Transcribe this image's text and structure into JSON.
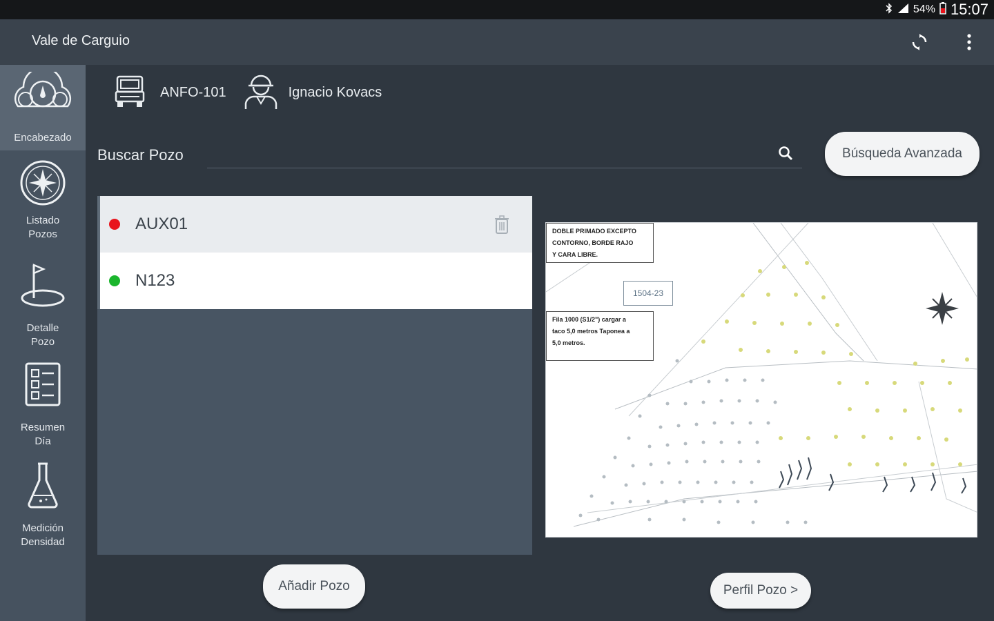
{
  "statusbar": {
    "battery": "54%",
    "time": "15:07"
  },
  "appbar": {
    "title": "Vale de Carguio"
  },
  "sidebar": {
    "items": [
      {
        "label": "Encabezado",
        "icon": "dashboard-gauge-icon",
        "active": true
      },
      {
        "label": "Listado Pozos",
        "icon": "compass-icon",
        "active": false
      },
      {
        "label": "Detalle Pozo",
        "icon": "flag-hole-icon",
        "active": false
      },
      {
        "label": "Resumen Día",
        "icon": "checklist-icon",
        "active": false
      },
      {
        "label": "Medición Densidad",
        "icon": "flask-icon",
        "active": false
      }
    ]
  },
  "header": {
    "truck": "ANFO-101",
    "operator": "Ignacio Kovacs"
  },
  "search": {
    "label": "Buscar Pozo",
    "placeholder": "",
    "advanced_button": "Búsqueda Avanzada"
  },
  "pozos": [
    {
      "name": "AUX01",
      "status_color": "#e8141c",
      "selected": true
    },
    {
      "name": "N123",
      "status_color": "#1ab52c",
      "selected": false
    }
  ],
  "buttons": {
    "add": "Añadir Pozo",
    "profile": "Perfil Pozo >"
  },
  "map": {
    "note1": [
      "DOBLE PRIMADO EXCEPTO",
      "CONTORNO, BORDE RAJO",
      "Y CARA LIBRE."
    ],
    "label": "1504-23",
    "note2": [
      "Fila 1000 (S1/2\") cargar a",
      "taco 5,0 metros Taponea a",
      "5,0 metros."
    ]
  },
  "colors": {
    "accent_red": "#e8141c",
    "accent_green": "#1ab52c",
    "sidebar": "#46525f",
    "background": "#2f3740"
  }
}
